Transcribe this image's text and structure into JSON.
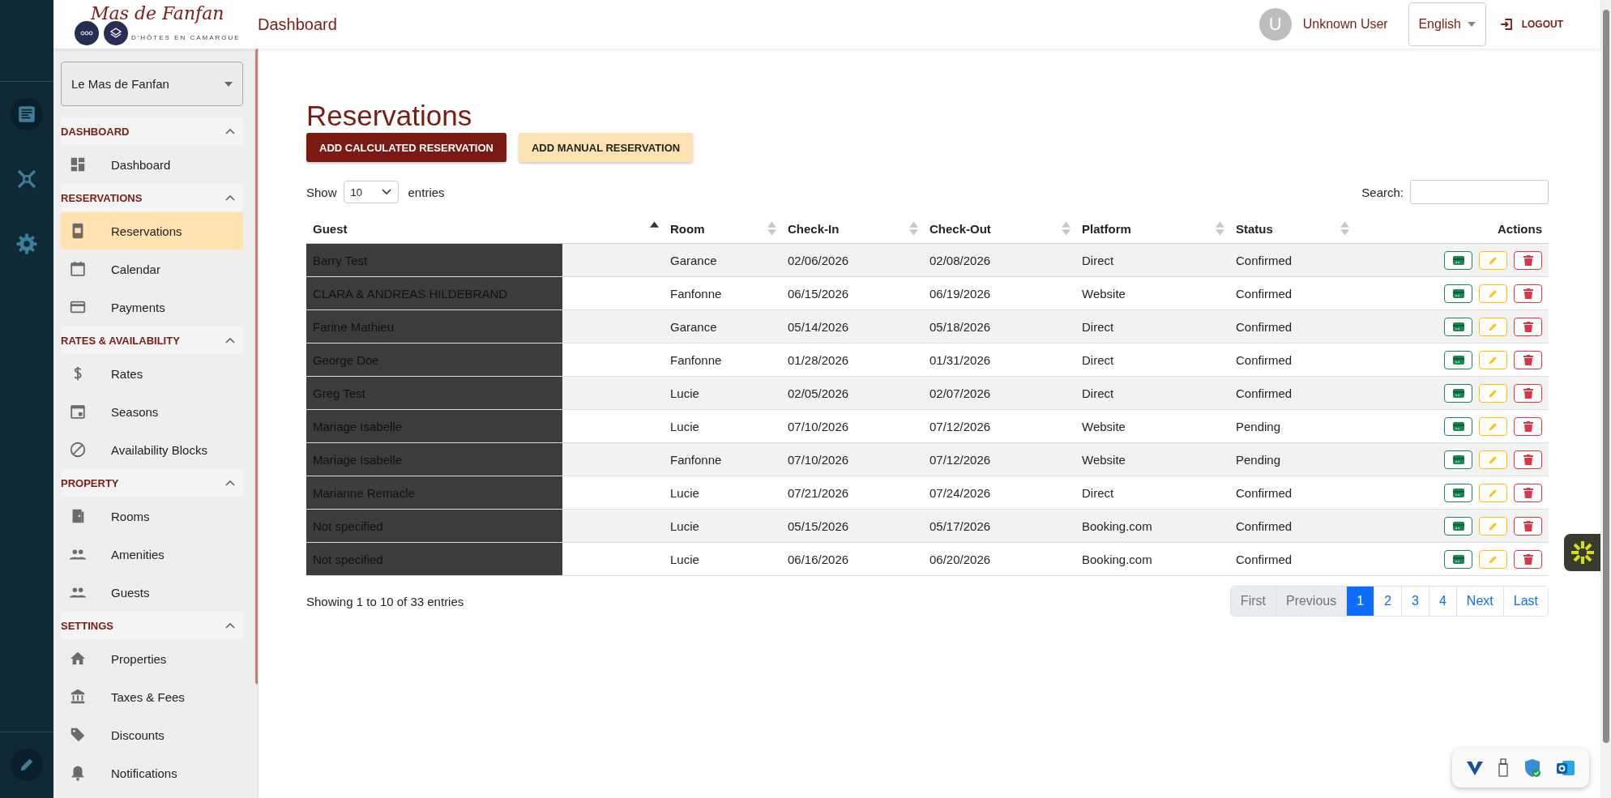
{
  "logo": {
    "title": "Mas de Fanfan",
    "subtitle": "D'HÔTES EN CAMARGUE"
  },
  "header": {
    "title": "Dashboard",
    "user_initial": "U",
    "user_name": "Unknown User",
    "language": "English",
    "logout": "LOGOUT"
  },
  "sidebar": {
    "property_select": "Le Mas de Fanfan",
    "sections": [
      {
        "title": "DASHBOARD",
        "expanded": true,
        "items": [
          {
            "label": "Dashboard",
            "selected": false
          }
        ]
      },
      {
        "title": "RESERVATIONS",
        "expanded": true,
        "items": [
          {
            "label": "Reservations",
            "selected": true
          },
          {
            "label": "Calendar",
            "selected": false
          },
          {
            "label": "Payments",
            "selected": false
          }
        ]
      },
      {
        "title": "RATES & AVAILABILITY",
        "expanded": true,
        "items": [
          {
            "label": "Rates",
            "selected": false
          },
          {
            "label": "Seasons",
            "selected": false
          },
          {
            "label": "Availability Blocks",
            "selected": false
          }
        ]
      },
      {
        "title": "PROPERTY",
        "expanded": true,
        "items": [
          {
            "label": "Rooms",
            "selected": false
          },
          {
            "label": "Amenities",
            "selected": false
          },
          {
            "label": "Guests",
            "selected": false
          }
        ]
      },
      {
        "title": "SETTINGS",
        "expanded": true,
        "items": [
          {
            "label": "Properties",
            "selected": false
          },
          {
            "label": "Taxes & Fees",
            "selected": false
          },
          {
            "label": "Discounts",
            "selected": false
          },
          {
            "label": "Notifications",
            "selected": false
          }
        ]
      }
    ]
  },
  "page": {
    "title": "Reservations",
    "buttons": [
      {
        "label": "ADD CALCULATED RESERVATION",
        "kind": "primary"
      },
      {
        "label": "ADD MANUAL RESERVATION",
        "kind": "secondary"
      }
    ]
  },
  "table": {
    "show_label": "Show",
    "page_size": "10",
    "entries_label": "entries",
    "search_label": "Search:",
    "columns": [
      {
        "label": "Guest",
        "sortable": true,
        "sorted": true
      },
      {
        "label": "Room",
        "sortable": true,
        "sorted": false
      },
      {
        "label": "Check-In",
        "sortable": true,
        "sorted": false
      },
      {
        "label": "Check-Out",
        "sortable": true,
        "sorted": false
      },
      {
        "label": "Platform",
        "sortable": true,
        "sorted": false
      },
      {
        "label": "Status",
        "sortable": true,
        "sorted": false
      },
      {
        "label": "Actions",
        "sortable": false
      }
    ],
    "rows": [
      {
        "guest": "Barry Test",
        "room": "Garance",
        "check_in": "02/06/2026",
        "check_out": "02/08/2026",
        "platform": "Direct",
        "status": "Confirmed"
      },
      {
        "guest": "CLARA & ANDREAS HILDEBRAND",
        "room": "Fanfonne",
        "check_in": "06/15/2026",
        "check_out": "06/19/2026",
        "platform": "Website",
        "status": "Confirmed"
      },
      {
        "guest": "Farine Mathieu",
        "room": "Garance",
        "check_in": "05/14/2026",
        "check_out": "05/18/2026",
        "platform": "Direct",
        "status": "Confirmed"
      },
      {
        "guest": "George Doe",
        "room": "Fanfonne",
        "check_in": "01/28/2026",
        "check_out": "01/31/2026",
        "platform": "Direct",
        "status": "Confirmed"
      },
      {
        "guest": "Greg Test",
        "room": "Lucie",
        "check_in": "02/05/2026",
        "check_out": "02/07/2026",
        "platform": "Direct",
        "status": "Confirmed"
      },
      {
        "guest": "Mariage Isabelle",
        "room": "Lucie",
        "check_in": "07/10/2026",
        "check_out": "07/12/2026",
        "platform": "Website",
        "status": "Pending"
      },
      {
        "guest": "Mariage Isabelle",
        "room": "Fanfonne",
        "check_in": "07/10/2026",
        "check_out": "07/12/2026",
        "platform": "Website",
        "status": "Pending"
      },
      {
        "guest": "Marianne Remacle",
        "room": "Lucie",
        "check_in": "07/21/2026",
        "check_out": "07/24/2026",
        "platform": "Direct",
        "status": "Confirmed"
      },
      {
        "guest": "Not specified",
        "room": "Lucie",
        "check_in": "05/15/2026",
        "check_out": "05/17/2026",
        "platform": "Booking.com",
        "status": "Confirmed"
      },
      {
        "guest": "Not specified",
        "room": "Lucie",
        "check_in": "06/16/2026",
        "check_out": "06/20/2026",
        "platform": "Booking.com",
        "status": "Confirmed"
      }
    ],
    "info": "Showing 1 to 10 of 33 entries",
    "pagination": [
      {
        "label": "First",
        "disabled": true,
        "selected": false
      },
      {
        "label": "Previous",
        "disabled": true,
        "selected": false
      },
      {
        "label": "1",
        "disabled": false,
        "selected": true
      },
      {
        "label": "2",
        "disabled": false,
        "selected": false
      },
      {
        "label": "3",
        "disabled": false,
        "selected": false
      },
      {
        "label": "4",
        "disabled": false,
        "selected": false
      },
      {
        "label": "Next",
        "disabled": false,
        "selected": false
      },
      {
        "label": "Last",
        "disabled": false,
        "selected": false
      }
    ]
  }
}
